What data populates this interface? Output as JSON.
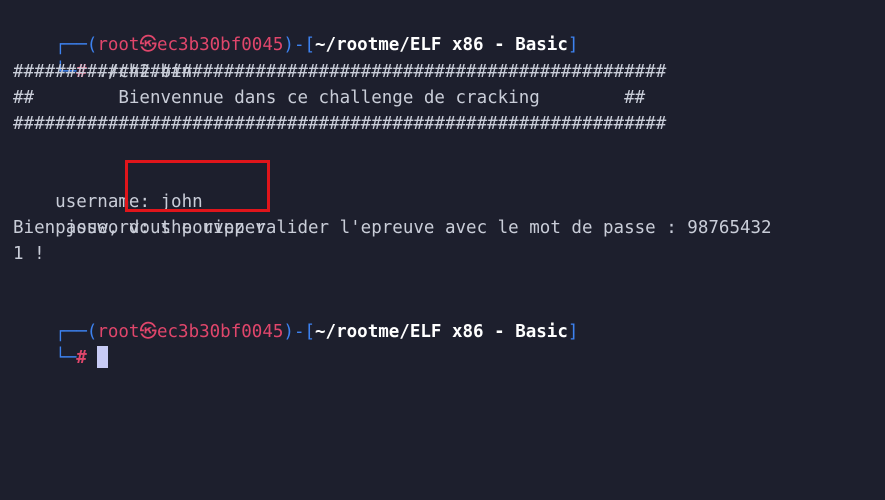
{
  "prompt1": {
    "corner_top": "┌──(",
    "user": "root",
    "sep": "㉿",
    "host": "ec3b30bf0045",
    "mid": ")-[",
    "path": "~/rootme/ELF x86 - Basic",
    "close": "]",
    "corner_bottom": "└─",
    "hash": "#",
    "command": " ./ch2.bin"
  },
  "banner": {
    "border": "##############################################################",
    "middle": "##        Bienvennue dans ce challenge de cracking        ##"
  },
  "login": {
    "username_label": "username: ",
    "username_value": "john",
    "password_label": "password: ",
    "password_value": "the ripper"
  },
  "result": {
    "line1": "Bien joue, vous pouvez valider l'epreuve avec le mot de passe : 98765432",
    "line2": "1 !"
  },
  "prompt2": {
    "corner_top": "┌──(",
    "user": "root",
    "sep": "㉿",
    "host": "ec3b30bf0045",
    "mid": ")-[",
    "path": "~/rootme/ELF x86 - Basic",
    "close": "]",
    "corner_bottom": "└─",
    "hash": "#"
  },
  "colors": {
    "background": "#1d1f2d",
    "prompt_frame": "#3d82f0",
    "prompt_user": "#e0466b",
    "highlight": "#e0151b",
    "cursor": "#c8cbf5"
  }
}
